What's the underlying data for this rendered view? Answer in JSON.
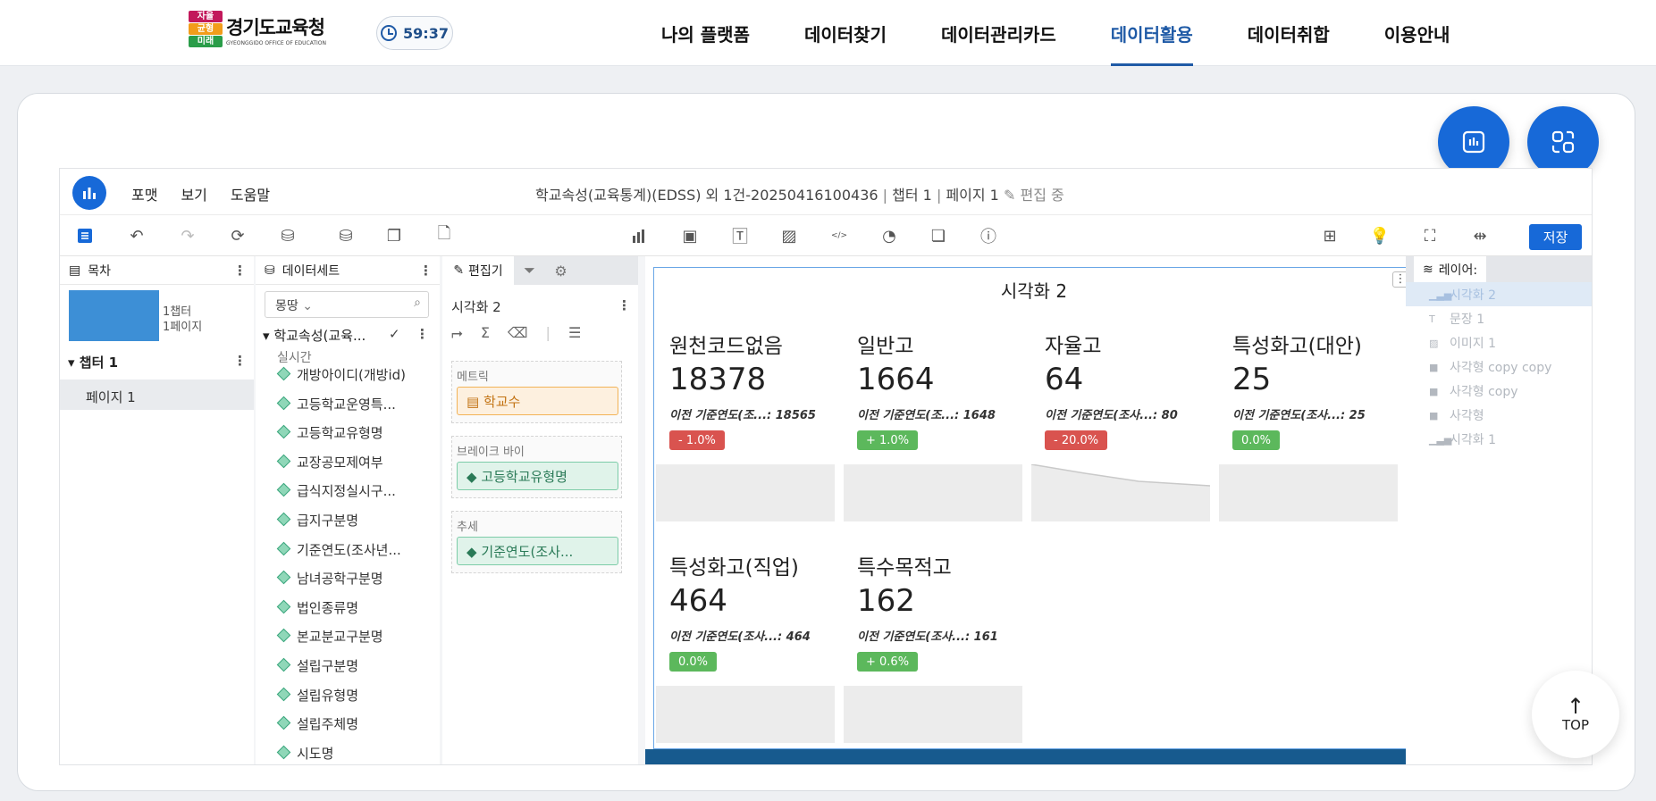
{
  "header": {
    "logo_badge": [
      "자율",
      "균형",
      "미래"
    ],
    "logo_title": "경기도교육청",
    "logo_sub": "GYEONGGIDO OFFICE OF EDUCATION",
    "timer": "59:37",
    "nav": [
      "나의 플랫폼",
      "데이터찾기",
      "데이터관리카드",
      "데이터활용",
      "데이터취합",
      "이용안내"
    ],
    "active_nav": "데이터활용"
  },
  "top_button": "TOP",
  "app": {
    "menu": [
      "포맷",
      "보기",
      "도움말"
    ],
    "doc_title": "학교속성(교육통계)(EDSS) 외 1건-20250416100436",
    "chapter_info": "챕터 1",
    "page_info": "페이지 1",
    "edit_status": "편집 중",
    "save_label": "저장"
  },
  "toc": {
    "header": "목차",
    "meta_chapters": "1챕터",
    "meta_pages": "1페이지",
    "chapter": "챕터 1",
    "page": "페이지 1"
  },
  "datasets": {
    "header": "데이터세트",
    "search_value": "몽땅",
    "dataset_name": "학교속성(교육...",
    "mode": "실시간",
    "fields": [
      "개방아이디(개방id)",
      "고등학교운영특...",
      "고등학교유형명",
      "교장공모제여부",
      "급식지정실시구...",
      "급지구분명",
      "기준연도(조사년...",
      "남녀공학구분명",
      "법인종류명",
      "본교분교구분명",
      "설립구분명",
      "설립유형명",
      "설립주체명",
      "시도명"
    ]
  },
  "editor": {
    "tab": "편집기",
    "viz_name": "시각화 2",
    "metric_label": "메트릭",
    "metric": "학교수",
    "breakby_label": "브레이크 바이",
    "breakby": "고등학교유형명",
    "trend_label": "추세",
    "trend": "기준연도(조사..."
  },
  "viz": {
    "title": "시각화 2",
    "kpis": [
      {
        "label": "원천코드없음",
        "value": "18378",
        "prev": "이전 기준연도(조...: 18565",
        "change": "- 1.0%",
        "status": "down"
      },
      {
        "label": "일반고",
        "value": "1664",
        "prev": "이전 기준연도(조...: 1648",
        "change": "+ 1.0%",
        "status": "up"
      },
      {
        "label": "자율고",
        "value": "64",
        "prev": "이전 기준연도(조사...: 80",
        "change": "- 20.0%",
        "status": "down"
      },
      {
        "label": "특성화고(대안)",
        "value": "25",
        "prev": "이전 기준연도(조사...: 25",
        "change": "0.0%",
        "status": "flat"
      },
      {
        "label": "특성화고(직업)",
        "value": "464",
        "prev": "이전 기준연도(조사...: 464",
        "change": "0.0%",
        "status": "flat"
      },
      {
        "label": "특수목적고",
        "value": "162",
        "prev": "이전 기준연도(조사...: 161",
        "change": "+ 0.6%",
        "status": "up"
      }
    ]
  },
  "layers": {
    "header": "레이어:",
    "items": [
      "시각화 2",
      "문장 1",
      "이미지 1",
      "사각형 copy copy",
      "사각형 copy",
      "사각형",
      "시각화 1"
    ]
  },
  "colors": {
    "brand": "#1769d8",
    "active_nav": "#1f5aa6",
    "down": "#d9534f",
    "up": "#5cb85c"
  }
}
